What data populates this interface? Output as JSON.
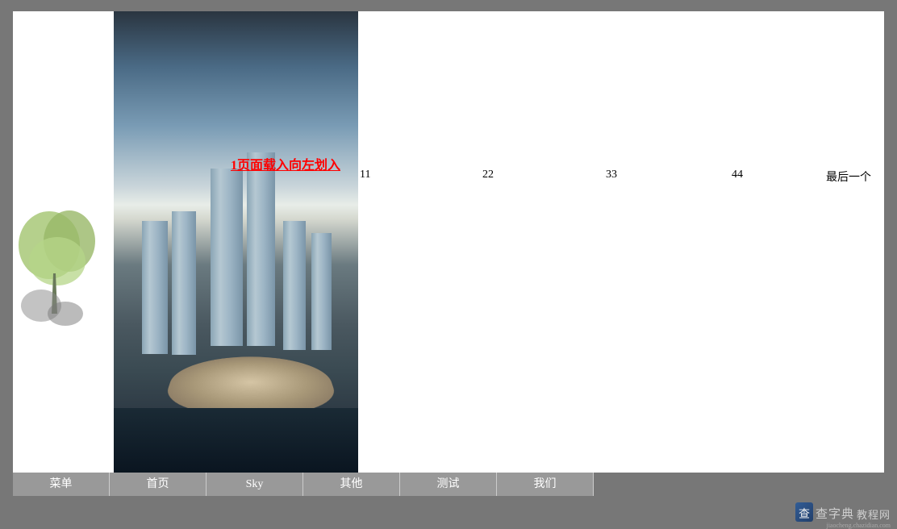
{
  "caption": "1页面载入向左划入",
  "labels": {
    "l1": "11",
    "l2": "22",
    "l3": "33",
    "l4": "44",
    "last": "最后一个"
  },
  "nav": {
    "items": [
      "菜单",
      "首页",
      "Sky",
      "其他",
      "测试",
      "我们"
    ]
  },
  "watermark": {
    "brand": "查字典",
    "suffix": "教程网",
    "url": "jiaocheng.chazidian.com"
  }
}
